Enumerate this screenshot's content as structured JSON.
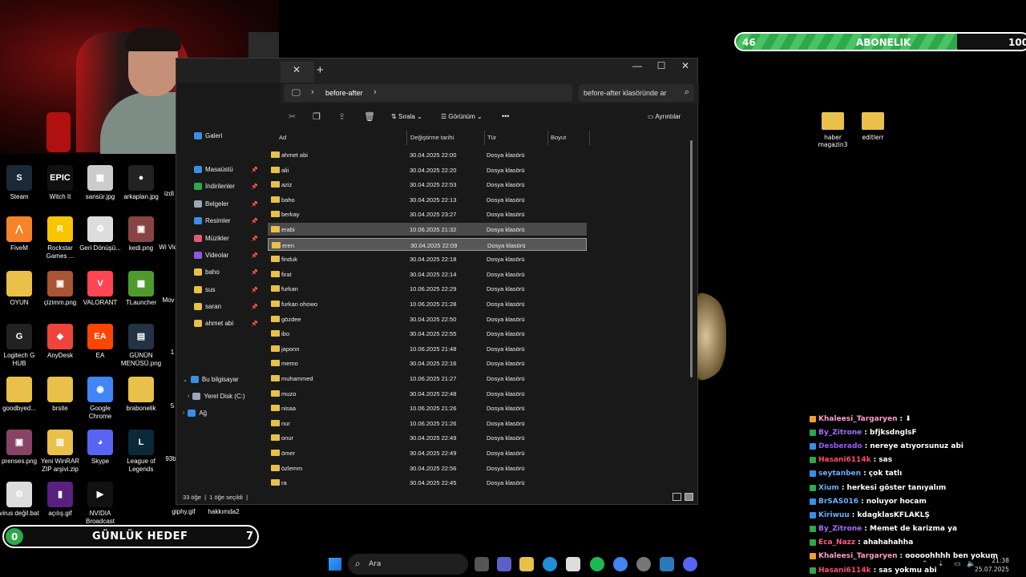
{
  "desktop_left": [
    {
      "label": "Steam",
      "color": "#1b2838",
      "glyph": "S"
    },
    {
      "label": "Witch It",
      "color": "#111111",
      "glyph": "EPIC"
    },
    {
      "label": "sansür.jpg",
      "color": "#cccccc",
      "glyph": "▦"
    },
    {
      "label": "arkaplan.jpg",
      "color": "#222222",
      "glyph": "●"
    },
    {
      "label": "FiveM",
      "color": "#f4832a",
      "glyph": "⋀"
    },
    {
      "label": "Rockstar Games ...",
      "color": "#f7c600",
      "glyph": "R"
    },
    {
      "label": "Geri Dönüşü...",
      "color": "#dddddd",
      "glyph": "♻"
    },
    {
      "label": "kedi.png",
      "color": "#884444",
      "glyph": "▣"
    },
    {
      "label": "OYUN",
      "color": "#e8c04a",
      "glyph": ""
    },
    {
      "label": "çizimm.png",
      "color": "#aa5533",
      "glyph": "▣"
    },
    {
      "label": "VALORANT",
      "color": "#ff4655",
      "glyph": "V"
    },
    {
      "label": "TLauncher",
      "color": "#4f9a2f",
      "glyph": "▩"
    },
    {
      "label": "Logitech G HUB",
      "color": "#222222",
      "glyph": "G"
    },
    {
      "label": "AnyDesk",
      "color": "#ef443b",
      "glyph": "◆"
    },
    {
      "label": "EA",
      "color": "#ff4500",
      "glyph": "EA"
    },
    {
      "label": "GÜNÜN MENÜSÜ.png",
      "color": "#223344",
      "glyph": "▤"
    },
    {
      "label": "goodbyed...",
      "color": "#e8c04a",
      "glyph": ""
    },
    {
      "label": "brsite",
      "color": "#e8c04a",
      "glyph": ""
    },
    {
      "label": "Google Chrome",
      "color": "#4285f4",
      "glyph": "◉"
    },
    {
      "label": "brabonelik",
      "color": "#e8c04a",
      "glyph": ""
    },
    {
      "label": "prenses.png",
      "color": "#884466",
      "glyph": "▣"
    },
    {
      "label": "Yeni WinRAR ZIP arşivi.zip",
      "color": "#e8c04a",
      "glyph": "▥"
    },
    {
      "label": "Skype",
      "color": "#5865f2",
      "glyph": "◕"
    },
    {
      "label": "League of Legends",
      "color": "#0a2a3a",
      "glyph": "L"
    },
    {
      "label": "virus değil.bat",
      "color": "#dddddd",
      "glyph": "⚙"
    },
    {
      "label": "açılış.gif",
      "color": "#5a2080",
      "glyph": "▮"
    },
    {
      "label": "NVIDIA Broadcast",
      "color": "#111111",
      "glyph": "▶"
    }
  ],
  "desktop_partial": [
    "izdi",
    "Wi Vide",
    "Mov",
    "1",
    "5",
    "93b",
    "giphy.gif",
    "hakkımda2"
  ],
  "explorer": {
    "tab_close": "✕",
    "tab_add": "+",
    "minimize": "—",
    "maximize": "☐",
    "close": "✕",
    "breadcrumb": "before-after",
    "search_placeholder": "before-after klasöründe ar",
    "toolbar": {
      "sort": "Sırala",
      "view": "Görünüm",
      "more": "•••",
      "details": "Ayrıntılar"
    },
    "sidebar": [
      {
        "label": "Galeri",
        "color": "#3a8ee6",
        "pin": false
      },
      {
        "label": "Masaüstü",
        "color": "#3a8ee6",
        "pin": true
      },
      {
        "label": "İndirilenler",
        "color": "#2ea84a",
        "pin": true
      },
      {
        "label": "Belgeler",
        "color": "#9aa7b8",
        "pin": true
      },
      {
        "label": "Resimler",
        "color": "#3a8ee6",
        "pin": true
      },
      {
        "label": "Müzikler",
        "color": "#e05a7a",
        "pin": true
      },
      {
        "label": "Videolar",
        "color": "#8a5ae0",
        "pin": true
      },
      {
        "label": "baho",
        "color": "#e8c04a",
        "pin": true
      },
      {
        "label": "sus",
        "color": "#e8c04a",
        "pin": true
      },
      {
        "label": "saran",
        "color": "#e8c04a",
        "pin": true
      },
      {
        "label": "ahmet abi",
        "color": "#e8c04a",
        "pin": true
      }
    ],
    "this_pc": "Bu bilgisayar",
    "local_disk": "Yerel Disk (C:)",
    "network": "Ağ",
    "columns": {
      "name": "Ad",
      "date": "Değiştirme tarihi",
      "type": "Tür",
      "size": "Boyut"
    },
    "files": [
      {
        "name": "ahmet abi",
        "date": "30.04.2025 22:00",
        "type": "Dosya klasörü"
      },
      {
        "name": "alii",
        "date": "30.04.2025 22:20",
        "type": "Dosya klasörü"
      },
      {
        "name": "aziz",
        "date": "30.04.2025 22:53",
        "type": "Dosya klasörü"
      },
      {
        "name": "baho",
        "date": "30.04.2025 22:13",
        "type": "Dosya klasörü"
      },
      {
        "name": "berkay",
        "date": "30.04.2025 23:27",
        "type": "Dosya klasörü"
      },
      {
        "name": "erabi",
        "date": "10.06.2025 21:32",
        "type": "Dosya klasörü",
        "state": "sel1"
      },
      {
        "name": "eren",
        "date": "30.04.2025 22:09",
        "type": "Dosya klasörü",
        "state": "sel2"
      },
      {
        "name": "finduk",
        "date": "30.04.2025 22:18",
        "type": "Dosya klasörü"
      },
      {
        "name": "firat",
        "date": "30.04.2025 22:14",
        "type": "Dosya klasörü"
      },
      {
        "name": "furkan",
        "date": "10.06.2025 22:29",
        "type": "Dosya klasörü"
      },
      {
        "name": "furkan ohowo",
        "date": "10.06.2025 21:28",
        "type": "Dosya klasörü"
      },
      {
        "name": "gözdee",
        "date": "30.04.2025 22:50",
        "type": "Dosya klasörü"
      },
      {
        "name": "ibo",
        "date": "30.04.2025 22:55",
        "type": "Dosya klasörü"
      },
      {
        "name": "japonn",
        "date": "10.06.2025 21:48",
        "type": "Dosya klasörü"
      },
      {
        "name": "memo",
        "date": "30.04.2025 22:16",
        "type": "Dosya klasörü"
      },
      {
        "name": "muhammed",
        "date": "10.06.2025 21:27",
        "type": "Dosya klasörü"
      },
      {
        "name": "muzo",
        "date": "30.04.2025 22:48",
        "type": "Dosya klasörü"
      },
      {
        "name": "nisaa",
        "date": "10.06.2025 21:26",
        "type": "Dosya klasörü"
      },
      {
        "name": "nur",
        "date": "10.06.2025 21:26",
        "type": "Dosya klasörü"
      },
      {
        "name": "onur",
        "date": "30.04.2025 22:49",
        "type": "Dosya klasörü"
      },
      {
        "name": "ömer",
        "date": "30.04.2025 22:49",
        "type": "Dosya klasörü"
      },
      {
        "name": "özlemm",
        "date": "30.04.2025 22:56",
        "type": "Dosya klasörü"
      },
      {
        "name": "ra",
        "date": "30.04.2025 22:45",
        "type": "Dosya klasörü"
      }
    ],
    "status": {
      "count": "33 öğe",
      "sep": "|",
      "selected": "1 öğe seçildi",
      "sep2": "|"
    }
  },
  "abonelik": {
    "current": "46",
    "label": "ABONELIK",
    "target": "100",
    "progress": 0.46
  },
  "desktop_right": [
    {
      "label": "haber magazin3"
    },
    {
      "label": "editlerr"
    }
  ],
  "chat": [
    {
      "user": "Khaleesi_Targaryen",
      "color": "#ff9ecb",
      "msg": ": ⬇"
    },
    {
      "user": "By_Zitrone",
      "color": "#a86cff",
      "msg": ": bfjksdnglsF"
    },
    {
      "user": "Desberado",
      "color": "#9b59ff",
      "msg": ": nereye atıyorsunuz abi"
    },
    {
      "user": "Hasani6114k",
      "color": "#ff4d6d",
      "msg": ": sas"
    },
    {
      "user": "seytanben",
      "color": "#6ab0ff",
      "msg": ": çok tatlı"
    },
    {
      "user": "Xium",
      "color": "#6ab0ff",
      "msg": ": herkesi göster tanıyalım"
    },
    {
      "user": "BrSAS016",
      "color": "#6ab0ff",
      "msg": ": noluyor hocam"
    },
    {
      "user": "Kiriwuu",
      "color": "#6ab0ff",
      "msg": ": kdagklasKFLAKLŞ"
    },
    {
      "user": "By_Zitrone",
      "color": "#a86cff",
      "msg": ": Memet de karizma ya"
    },
    {
      "user": "Eca_Nazz",
      "color": "#ff5a8a",
      "msg": ": ahahahahha"
    },
    {
      "user": "Khaleesi_Targaryen",
      "color": "#ff9ecb",
      "msg": ": ooooohhhh ben yokum"
    },
    {
      "user": "Hasani6114k",
      "color": "#ff4d6d",
      "msg": ": sas yokmu abi"
    }
  ],
  "goal": {
    "current": "0",
    "label": "GÜNLÜK HEDEF",
    "target": "7"
  },
  "taskbar": {
    "search": "Ara",
    "search_icon": "🔍",
    "time": "21:38",
    "date": "25.07.2025"
  }
}
